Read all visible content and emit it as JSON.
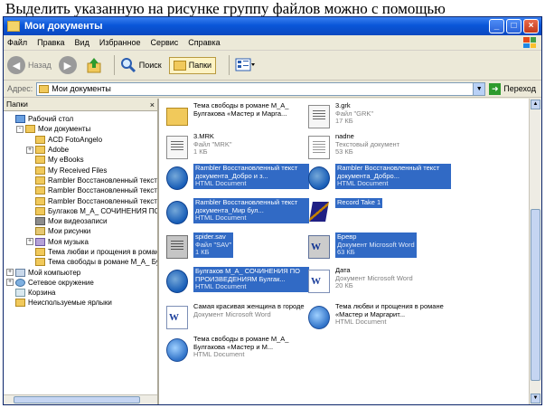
{
  "question": "Выделить указанную на рисунке группу файлов можно с помощью",
  "window": {
    "title": "Мои документы",
    "buttons": {
      "minimize": "_",
      "maximize": "□",
      "close": "×"
    }
  },
  "menu": [
    "Файл",
    "Правка",
    "Вид",
    "Избранное",
    "Сервис",
    "Справка"
  ],
  "toolbar": {
    "back": "Назад",
    "search": "Поиск",
    "folders": "Папки"
  },
  "address": {
    "label": "Адрес:",
    "value": "Мои документы",
    "go": "Переход"
  },
  "folders_pane": {
    "header": "Папки",
    "close": "×",
    "tree": [
      {
        "label": "Рабочий стол",
        "exp": "",
        "indent": 0,
        "icon": "desk"
      },
      {
        "label": "Мои документы",
        "exp": "-",
        "indent": 1,
        "icon": "folder"
      },
      {
        "label": "ACD FotoAngelo",
        "exp": "",
        "indent": 2,
        "icon": "folder"
      },
      {
        "label": "Adobe",
        "exp": "+",
        "indent": 2,
        "icon": "folder"
      },
      {
        "label": "My eBooks",
        "exp": "",
        "indent": 2,
        "icon": "folder"
      },
      {
        "label": "My Received Files",
        "exp": "",
        "indent": 2,
        "icon": "folder"
      },
      {
        "label": "Rambler Восстановленный текст",
        "exp": "",
        "indent": 2,
        "icon": "folder"
      },
      {
        "label": "Rambler Восстановленный текст",
        "exp": "",
        "indent": 2,
        "icon": "folder"
      },
      {
        "label": "Rambler Восстановленный текст",
        "exp": "",
        "indent": 2,
        "icon": "folder"
      },
      {
        "label": "Булгаков М_А_ СОЧИНЕНИЯ ПО",
        "exp": "",
        "indent": 2,
        "icon": "folder"
      },
      {
        "label": "Мои видеозаписи",
        "exp": "",
        "indent": 2,
        "icon": "film"
      },
      {
        "label": "Мои рисунки",
        "exp": "",
        "indent": 2,
        "icon": "pic"
      },
      {
        "label": "Моя музыка",
        "exp": "+",
        "indent": 2,
        "icon": "music"
      },
      {
        "label": "Тема любви и прощения в романе",
        "exp": "",
        "indent": 2,
        "icon": "folder"
      },
      {
        "label": "Тема свободы в романе М_А_ Бу",
        "exp": "",
        "indent": 2,
        "icon": "folder"
      },
      {
        "label": "Мой компьютер",
        "exp": "+",
        "indent": 0,
        "icon": "comp"
      },
      {
        "label": "Сетевое окружение",
        "exp": "+",
        "indent": 0,
        "icon": "net"
      },
      {
        "label": "Корзина",
        "exp": "",
        "indent": 0,
        "icon": "bin"
      },
      {
        "label": "Неиспользуемые ярлыки",
        "exp": "",
        "indent": 0,
        "icon": "star"
      }
    ]
  },
  "files": [
    {
      "name": "Тема свободы в романе М_А_ Булгакова «Мастер и Марга...",
      "sub": "",
      "icon": "folder",
      "sel": false,
      "col": 0,
      "row": 0
    },
    {
      "name": "3.grk",
      "sub": "Файл \"GRK\"\n17 КБ",
      "icon": "gen",
      "sel": false,
      "col": 1,
      "row": 0
    },
    {
      "name": "3.MRK",
      "sub": "Файл \"MRK\"\n1 КБ",
      "icon": "gen",
      "sel": false,
      "col": 0,
      "row": 1
    },
    {
      "name": "nadne",
      "sub": "Текстовый документ\n53 КБ",
      "icon": "txt",
      "sel": false,
      "col": 1,
      "row": 1
    },
    {
      "name": "Rambler Восстановленный текст документа_Добро и з...",
      "sub": "HTML Document",
      "icon": "html",
      "sel": true,
      "col": 0,
      "row": 2
    },
    {
      "name": "Rambler Восстановленный текст документа_Добро...",
      "sub": "HTML Document",
      "icon": "html",
      "sel": true,
      "col": 1,
      "row": 2
    },
    {
      "name": "Rambler Восстановленный текст документа_Мир бул...",
      "sub": "HTML Document",
      "icon": "html",
      "sel": true,
      "col": 0,
      "row": 3
    },
    {
      "name": "Record Take 1",
      "sub": "",
      "icon": "media",
      "sel": true,
      "col": 1,
      "row": 3
    },
    {
      "name": "spider.sav",
      "sub": "Файл \"SAV\"\n1 КБ",
      "icon": "gen",
      "sel": true,
      "col": 0,
      "row": 4
    },
    {
      "name": "Бревр",
      "sub": "Документ Microsoft Word\n63 КБ",
      "icon": "doc",
      "sel": true,
      "col": 1,
      "row": 4
    },
    {
      "name": "Булгаков М_А_ СОЧИНЕНИЯ ПО ПРОИЗВЕДЕНИЯМ Булгак...",
      "sub": "HTML Document",
      "icon": "html",
      "sel": true,
      "col": 0,
      "row": 5
    },
    {
      "name": "Дата",
      "sub": "Документ Microsoft Word\n20 КБ",
      "icon": "doc",
      "sel": false,
      "col": 1,
      "row": 5
    },
    {
      "name": "Самая красивая женщина в городе",
      "sub": "Документ Microsoft Word",
      "icon": "doc",
      "sel": false,
      "col": 0,
      "row": 6
    },
    {
      "name": "Тема любви и прощения в романе «Мастер и Маргарит...",
      "sub": "HTML Document",
      "icon": "html",
      "sel": false,
      "col": 1,
      "row": 6
    },
    {
      "name": "Тема свободы в романе М_А_ Булгакова «Мастер и М...",
      "sub": "HTML Document",
      "icon": "html",
      "sel": false,
      "col": 0,
      "row": 7
    }
  ],
  "colors": {
    "title_bar": "#0a56d8",
    "selection": "#316ac5",
    "window_bg": "#ece9d8"
  }
}
